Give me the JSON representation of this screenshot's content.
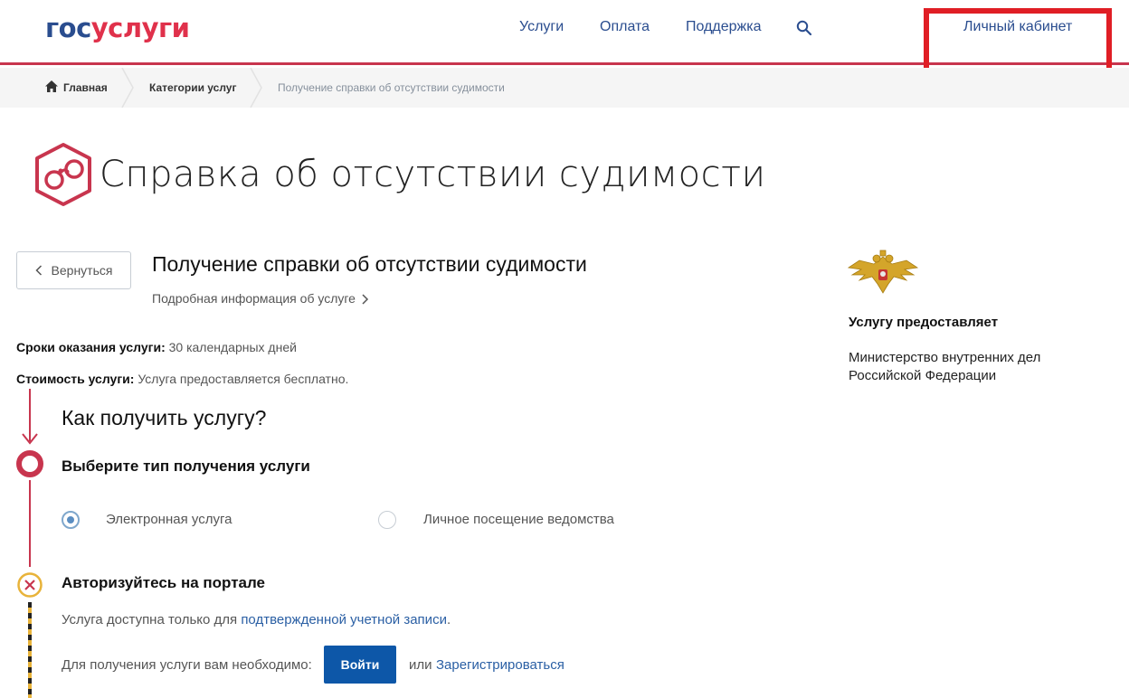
{
  "header": {
    "logo_gos": "гос",
    "logo_uslugi": "услуги",
    "nav": [
      "Услуги",
      "Оплата",
      "Поддержка"
    ],
    "personal_account": "Личный кабинет"
  },
  "breadcrumb": {
    "home": "Главная",
    "category": "Категории услуг",
    "current": "Получение справки об отсутствии судимости"
  },
  "page": {
    "title": "Справка об отсутствии судимости",
    "back_label": "Вернуться",
    "service_title": "Получение справки об отсутствии судимости",
    "more_info": "Подробная информация об услуге",
    "term_label": "Сроки оказания услуги:",
    "term_value": "30 календарных дней",
    "cost_label": "Стоимость услуги:",
    "cost_value": "Услуга предоставляется бесплатно."
  },
  "how": {
    "title": "Как получить услугу?",
    "step1_title": "Выберите тип получения услуги",
    "option_electronic": "Электронная услуга",
    "option_visit": "Личное посещение ведомства",
    "selected_option": "Электронная услуга",
    "step2_title": "Авторизуйтесь на портале",
    "auth_text": "Услуга доступна только для",
    "auth_link": "подтвержденной учетной записи",
    "auth_end": ".",
    "need_text": "Для получения услуги вам необходимо:",
    "login_button": "Войти",
    "or_text": "или",
    "register_link": "Зарегистрироваться"
  },
  "provider": {
    "title": "Услугу предоставляет",
    "name": "Министерство внутренних дел Российской Федерации"
  },
  "colors": {
    "brand_blue": "#2a4d8f",
    "brand_red": "#e0314b",
    "accent_crimson": "#c8354e",
    "button_blue": "#0d57a8",
    "highlight_red": "#e01e25",
    "warning_yellow": "#e8b33a"
  }
}
